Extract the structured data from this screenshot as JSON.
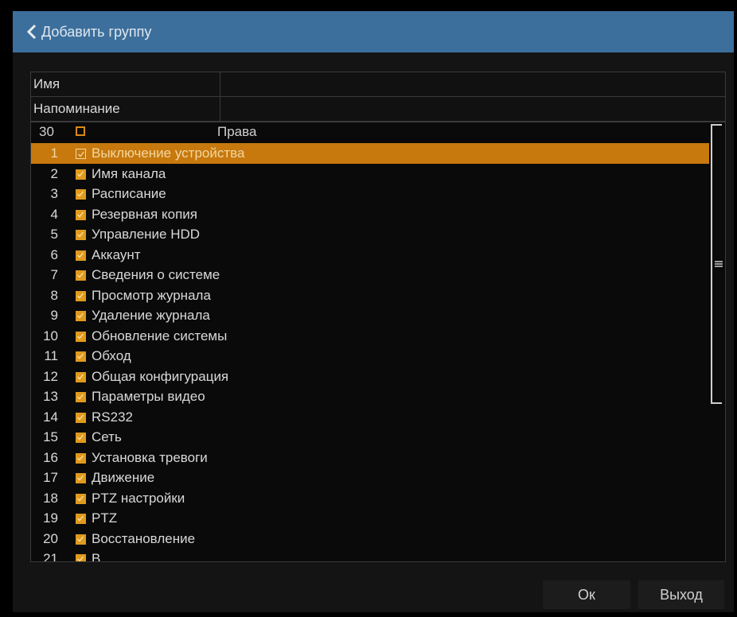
{
  "header": {
    "title": "Добавить группу"
  },
  "form": {
    "name_label": "Имя",
    "reminder_label": "Напоминание"
  },
  "list": {
    "count": "30",
    "column_title": "Права",
    "items": [
      {
        "num": "1",
        "label": "Выключение устройства",
        "selected": true
      },
      {
        "num": "2",
        "label": "Имя канала"
      },
      {
        "num": "3",
        "label": "Расписание"
      },
      {
        "num": "4",
        "label": "Резервная копия"
      },
      {
        "num": "5",
        "label": "Управление HDD"
      },
      {
        "num": "6",
        "label": "Аккаунт"
      },
      {
        "num": "7",
        "label": "Сведения о системе"
      },
      {
        "num": "8",
        "label": "Просмотр журнала"
      },
      {
        "num": "9",
        "label": "Удаление журнала"
      },
      {
        "num": "10",
        "label": "Обновление системы"
      },
      {
        "num": "11",
        "label": "Обход"
      },
      {
        "num": "12",
        "label": "Общая конфигурация"
      },
      {
        "num": "13",
        "label": "Параметры видео"
      },
      {
        "num": "14",
        "label": "RS232"
      },
      {
        "num": "15",
        "label": "Сеть"
      },
      {
        "num": "16",
        "label": "Установка тревоги"
      },
      {
        "num": "17",
        "label": "Движение"
      },
      {
        "num": "18",
        "label": "PTZ настройки"
      },
      {
        "num": "19",
        "label": "PTZ"
      },
      {
        "num": "20",
        "label": "Восстановление"
      },
      {
        "num": "21",
        "label": "В"
      }
    ]
  },
  "buttons": {
    "ok": "Ок",
    "exit": "Выход"
  },
  "colors": {
    "header_bg": "#3c6f9c",
    "accent": "#e09a1c",
    "selected_row": "#c7790e"
  }
}
